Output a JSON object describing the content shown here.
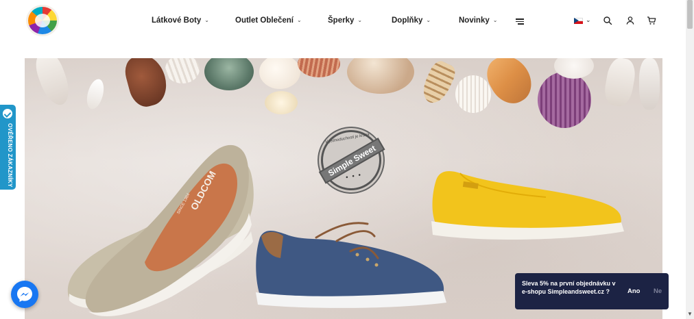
{
  "nav": {
    "items": [
      {
        "label": "Látkové Boty"
      },
      {
        "label": "Outlet Oblečení"
      },
      {
        "label": "Šperky"
      },
      {
        "label": "Doplňky"
      },
      {
        "label": "Novinky"
      }
    ]
  },
  "header": {
    "language": "CZ",
    "icons": [
      "menu-icon",
      "search-icon",
      "user-icon",
      "cart-icon"
    ]
  },
  "hero": {
    "seal_top_text": "V jednoduchosti je krása",
    "seal_brand": "Simple Sweet",
    "shoe_brand_text": "OLDCOM",
    "shoe_insole_text": "SINCE 1984"
  },
  "verified_tab": {
    "label": "OVĚŘENO ZÁKAZNÍKY"
  },
  "popup": {
    "message": "Sleva 5% na první objednávku v e-shopu Simpleandsweet.cz ?",
    "yes_label": "Ano",
    "no_label": "Ne"
  },
  "colors": {
    "popup_bg": "#1c2344",
    "verified_blue": "#2196c9",
    "messenger_blue": "#1877f2"
  }
}
